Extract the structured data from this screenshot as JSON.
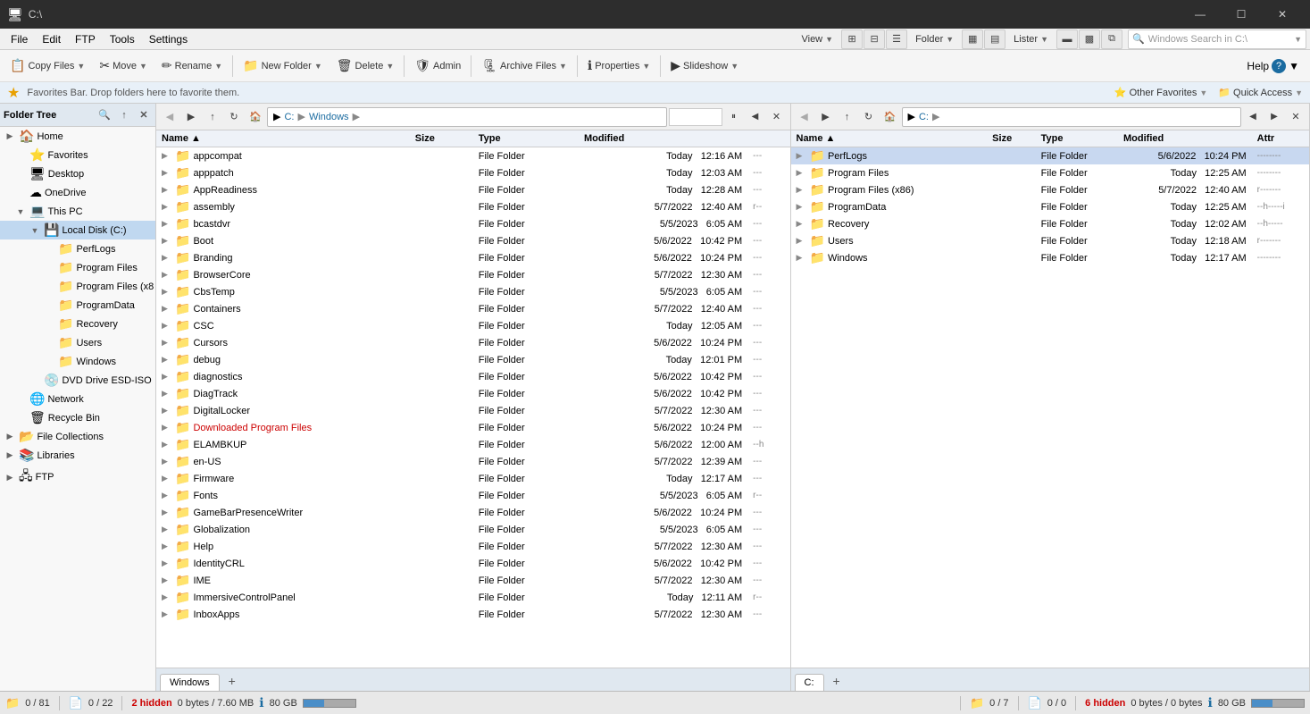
{
  "titleBar": {
    "icon": "🖥",
    "title": "C:\\",
    "minimize": "—",
    "maximize": "☐",
    "close": "✕"
  },
  "menuBar": {
    "items": [
      "File",
      "Edit",
      "FTP",
      "Tools",
      "Settings"
    ]
  },
  "toolbar": {
    "copyFiles": "Copy Files",
    "move": "Move",
    "rename": "Rename",
    "newFolder": "New Folder",
    "delete": "Delete",
    "admin": "Admin",
    "archiveFiles": "Archive Files",
    "properties": "Properties",
    "slideshow": "Slideshow",
    "view": "View",
    "folder": "Folder",
    "lister": "Lister",
    "help": "Help"
  },
  "favBar": {
    "text": "Favorites Bar. Drop folders here to favorite them.",
    "otherFavorites": "Other Favorites",
    "quickAccess": "Quick Access"
  },
  "folderTree": {
    "title": "Folder Tree",
    "items": [
      {
        "label": "Home",
        "icon": "🏠",
        "indent": 0,
        "expand": false
      },
      {
        "label": "Favorites",
        "icon": "⭐",
        "indent": 1,
        "expand": false
      },
      {
        "label": "Desktop",
        "icon": "🖥",
        "indent": 1,
        "expand": false
      },
      {
        "label": "OneDrive",
        "icon": "☁",
        "indent": 1,
        "expand": false
      },
      {
        "label": "This PC",
        "icon": "💻",
        "indent": 1,
        "expand": true
      },
      {
        "label": "Local Disk (C:)",
        "icon": "💾",
        "indent": 2,
        "expand": true
      },
      {
        "label": "PerfLogs",
        "icon": "📁",
        "indent": 3,
        "expand": false
      },
      {
        "label": "Program Files",
        "icon": "📁",
        "indent": 3,
        "expand": false
      },
      {
        "label": "Program Files (x8",
        "icon": "📁",
        "indent": 3,
        "expand": false
      },
      {
        "label": "ProgramData",
        "icon": "📁",
        "indent": 3,
        "expand": false
      },
      {
        "label": "Recovery",
        "icon": "📁",
        "indent": 3,
        "expand": false
      },
      {
        "label": "Users",
        "icon": "📁",
        "indent": 3,
        "expand": false
      },
      {
        "label": "Windows",
        "icon": "📁",
        "indent": 3,
        "expand": false
      },
      {
        "label": "DVD Drive ESD-ISO",
        "icon": "💿",
        "indent": 2,
        "expand": false
      },
      {
        "label": "Network",
        "icon": "🌐",
        "indent": 1,
        "expand": false
      },
      {
        "label": "Recycle Bin",
        "icon": "🗑",
        "indent": 1,
        "expand": false
      },
      {
        "label": "File Collections",
        "icon": "📂",
        "indent": 0,
        "expand": false
      },
      {
        "label": "Libraries",
        "icon": "📚",
        "indent": 0,
        "expand": false
      },
      {
        "label": "FTP",
        "icon": "🖧",
        "indent": 0,
        "expand": false
      }
    ]
  },
  "leftPane": {
    "path": [
      "C:",
      "Windows"
    ],
    "tab": "Windows",
    "columns": [
      "Name",
      "Size",
      "Type",
      "Modified",
      ""
    ],
    "files": [
      {
        "name": "appcompat",
        "size": "",
        "type": "File Folder",
        "date": "Today",
        "time": "12:16 AM",
        "attr": "---",
        "red": false
      },
      {
        "name": "apppatch",
        "size": "",
        "type": "File Folder",
        "date": "Today",
        "time": "12:03 AM",
        "attr": "---",
        "red": false
      },
      {
        "name": "AppReadiness",
        "size": "",
        "type": "File Folder",
        "date": "Today",
        "time": "12:28 AM",
        "attr": "---",
        "red": false
      },
      {
        "name": "assembly",
        "size": "",
        "type": "File Folder",
        "date": "5/7/2022",
        "time": "12:40 AM",
        "attr": "r--",
        "red": false
      },
      {
        "name": "bcastdvr",
        "size": "",
        "type": "File Folder",
        "date": "5/5/2023",
        "time": "6:05 AM",
        "attr": "---",
        "red": false
      },
      {
        "name": "Boot",
        "size": "",
        "type": "File Folder",
        "date": "5/6/2022",
        "time": "10:42 PM",
        "attr": "---",
        "red": false
      },
      {
        "name": "Branding",
        "size": "",
        "type": "File Folder",
        "date": "5/6/2022",
        "time": "10:24 PM",
        "attr": "---",
        "red": false
      },
      {
        "name": "BrowserCore",
        "size": "",
        "type": "File Folder",
        "date": "5/7/2022",
        "time": "12:30 AM",
        "attr": "---",
        "red": false
      },
      {
        "name": "CbsTemp",
        "size": "",
        "type": "File Folder",
        "date": "5/5/2023",
        "time": "6:05 AM",
        "attr": "---",
        "red": false
      },
      {
        "name": "Containers",
        "size": "",
        "type": "File Folder",
        "date": "5/7/2022",
        "time": "12:40 AM",
        "attr": "---",
        "red": false
      },
      {
        "name": "CSC",
        "size": "",
        "type": "File Folder",
        "date": "Today",
        "time": "12:05 AM",
        "attr": "---",
        "red": false
      },
      {
        "name": "Cursors",
        "size": "",
        "type": "File Folder",
        "date": "5/6/2022",
        "time": "10:24 PM",
        "attr": "---",
        "red": false
      },
      {
        "name": "debug",
        "size": "",
        "type": "File Folder",
        "date": "Today",
        "time": "12:01 PM",
        "attr": "---",
        "red": false
      },
      {
        "name": "diagnostics",
        "size": "",
        "type": "File Folder",
        "date": "5/6/2022",
        "time": "10:42 PM",
        "attr": "---",
        "red": false
      },
      {
        "name": "DiagTrack",
        "size": "",
        "type": "File Folder",
        "date": "5/6/2022",
        "time": "10:42 PM",
        "attr": "---",
        "red": false
      },
      {
        "name": "DigitalLocker",
        "size": "",
        "type": "File Folder",
        "date": "5/7/2022",
        "time": "12:30 AM",
        "attr": "---",
        "red": false
      },
      {
        "name": "Downloaded Program Files",
        "size": "",
        "type": "File Folder",
        "date": "5/6/2022",
        "time": "10:24 PM",
        "attr": "---",
        "red": true
      },
      {
        "name": "ELAMBKUP",
        "size": "",
        "type": "File Folder",
        "date": "5/6/2022",
        "time": "12:00 AM",
        "attr": "--h",
        "red": false
      },
      {
        "name": "en-US",
        "size": "",
        "type": "File Folder",
        "date": "5/7/2022",
        "time": "12:39 AM",
        "attr": "---",
        "red": false
      },
      {
        "name": "Firmware",
        "size": "",
        "type": "File Folder",
        "date": "Today",
        "time": "12:17 AM",
        "attr": "---",
        "red": false
      },
      {
        "name": "Fonts",
        "size": "",
        "type": "File Folder",
        "date": "5/5/2023",
        "time": "6:05 AM",
        "attr": "r--",
        "red": false
      },
      {
        "name": "GameBarPresenceWriter",
        "size": "",
        "type": "File Folder",
        "date": "5/6/2022",
        "time": "10:24 PM",
        "attr": "---",
        "red": false
      },
      {
        "name": "Globalization",
        "size": "",
        "type": "File Folder",
        "date": "5/5/2023",
        "time": "6:05 AM",
        "attr": "---",
        "red": false
      },
      {
        "name": "Help",
        "size": "",
        "type": "File Folder",
        "date": "5/7/2022",
        "time": "12:30 AM",
        "attr": "---",
        "red": false
      },
      {
        "name": "IdentityCRL",
        "size": "",
        "type": "File Folder",
        "date": "5/6/2022",
        "time": "10:42 PM",
        "attr": "---",
        "red": false
      },
      {
        "name": "IME",
        "size": "",
        "type": "File Folder",
        "date": "5/7/2022",
        "time": "12:30 AM",
        "attr": "---",
        "red": false
      },
      {
        "name": "ImmersiveControlPanel",
        "size": "",
        "type": "File Folder",
        "date": "Today",
        "time": "12:11 AM",
        "attr": "r--",
        "red": false
      },
      {
        "name": "InboxApps",
        "size": "",
        "type": "File Folder",
        "date": "5/7/2022",
        "time": "12:30 AM",
        "attr": "---",
        "red": false
      }
    ],
    "statusLeft": "0 / 81",
    "statusFile": "0 / 22",
    "hidden": "2 hidden",
    "bytes": "0 bytes / 7.60 MB",
    "disk": "80 GB",
    "diskFill": 40
  },
  "rightPane": {
    "path": [
      "C:"
    ],
    "tab": "C:",
    "columns": [
      "Name",
      "Size",
      "Type",
      "Modified",
      "Attr"
    ],
    "files": [
      {
        "name": "PerfLogs",
        "size": "",
        "type": "File Folder",
        "date": "5/6/2022",
        "time": "10:24 PM",
        "attr": "--------",
        "selected": true
      },
      {
        "name": "Program Files",
        "size": "",
        "type": "File Folder",
        "date": "Today",
        "time": "12:25 AM",
        "attr": "--------"
      },
      {
        "name": "Program Files (x86)",
        "size": "",
        "type": "File Folder",
        "date": "5/7/2022",
        "time": "12:40 AM",
        "attr": "r-------"
      },
      {
        "name": "ProgramData",
        "size": "",
        "type": "File Folder",
        "date": "Today",
        "time": "12:25 AM",
        "attr": "--h-----i"
      },
      {
        "name": "Recovery",
        "size": "",
        "type": "File Folder",
        "date": "Today",
        "time": "12:02 AM",
        "attr": "--h-----"
      },
      {
        "name": "Users",
        "size": "",
        "type": "File Folder",
        "date": "Today",
        "time": "12:18 AM",
        "attr": "r-------"
      },
      {
        "name": "Windows",
        "size": "",
        "type": "File Folder",
        "date": "Today",
        "time": "12:17 AM",
        "attr": "--------"
      }
    ],
    "statusLeft": "0 / 7",
    "statusFile": "0 / 0",
    "hidden": "6 hidden",
    "bytes": "0 bytes / 0 bytes",
    "disk": "80 GB",
    "diskFill": 40
  },
  "windowsSearch": {
    "placeholder": "Windows Search in C:\\"
  }
}
